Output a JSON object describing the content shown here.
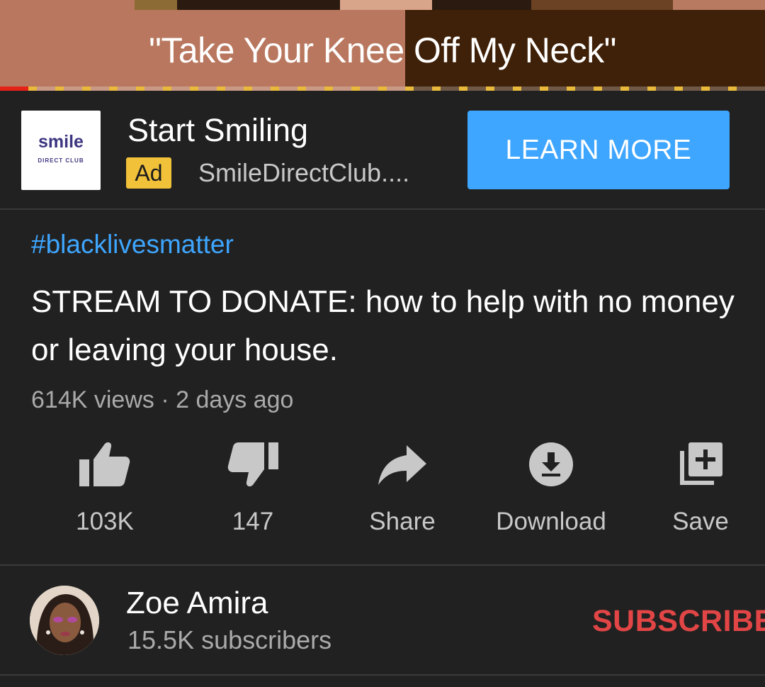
{
  "player": {
    "caption": "\"Take Your Knee Off My Neck\"",
    "progress_fraction": 0.038
  },
  "ad": {
    "logo_text": "smile",
    "logo_subtext": "DIRECT CLUB",
    "title": "Start Smiling",
    "badge": "Ad",
    "domain": "SmileDirectClub....",
    "cta_label": "LEARN MORE",
    "cta_color": "#3ea6ff"
  },
  "video": {
    "hashtag": "#blacklivesmatter",
    "title": "STREAM TO DONATE: how to help with no money or leaving your house.",
    "meta": "614K views · 2 days ago"
  },
  "actions": [
    {
      "label": "103K",
      "icon": "thumbs-up-icon"
    },
    {
      "label": "147",
      "icon": "thumbs-down-icon"
    },
    {
      "label": "Share",
      "icon": "share-icon"
    },
    {
      "label": "Download",
      "icon": "download-icon"
    },
    {
      "label": "Save",
      "icon": "save-playlist-icon"
    }
  ],
  "channel": {
    "name": "Zoe Amira",
    "subscribers": "15.5K subscribers",
    "subscribe_label": "SUBSCRIBE",
    "subscribe_color": "#e24545"
  }
}
